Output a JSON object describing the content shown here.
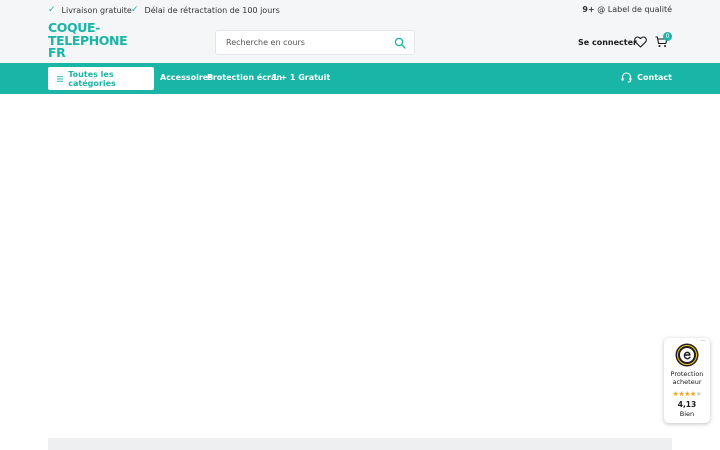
{
  "topbar": {
    "usp": [
      "Livraison gratuite",
      "Délai de rétractation de 100 jours"
    ],
    "quality_bold": "9+",
    "quality_rest": " @ Label de qualité"
  },
  "header": {
    "logo_lines": [
      "COQUE-",
      "TELEPHONE",
      "FR"
    ],
    "search_placeholder": "Recherche en cours",
    "signin": "Se connecter",
    "cart_count": "0"
  },
  "nav": {
    "all_categories": "Toutes les catégories",
    "links": [
      "Accessoires",
      "Protection écran",
      "1 + 1 Gratuit"
    ],
    "contact": "Contact"
  },
  "trust_widget": {
    "more": "···",
    "label_line1": "Protection",
    "label_line2": "acheteur",
    "rating": 4.13,
    "rating_text": "4,13",
    "rating_word": "Bien",
    "stars_max": 5
  },
  "colors": {
    "accent": "#19b5a6",
    "star": "#f4a41d"
  }
}
